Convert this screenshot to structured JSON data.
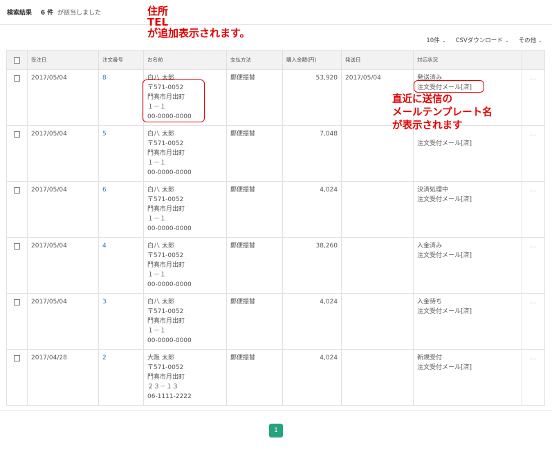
{
  "header": {
    "title": "検索結果",
    "count": "6 件",
    "message": "が該当しました"
  },
  "controls": {
    "page_size": "10件",
    "csv": "CSVダウンロード",
    "other": "その他"
  },
  "table": {
    "headers": [
      "受注日",
      "注文番号",
      "お名前",
      "支払方法",
      "購入金額(円)",
      "発送日",
      "対応状況"
    ],
    "rows": [
      {
        "date": "2017/05/04",
        "order": "8",
        "name": "白八 太郎",
        "zip": "〒571-0052",
        "addr1": "門真市月出町",
        "addr2": "１－１",
        "tel": "00-0000-0000",
        "pay": "郵便振替",
        "amount": "53,920",
        "ship": "2017/05/04",
        "status": "発送済み",
        "mail": "注文受付メール[済]"
      },
      {
        "date": "2017/05/04",
        "order": "5",
        "name": "白八 太郎",
        "zip": "〒571-0052",
        "addr1": "門真市月出町",
        "addr2": "１－１",
        "tel": "00-0000-0000",
        "pay": "郵便振替",
        "amount": "7,048",
        "ship": "",
        "status": "",
        "mail": "注文受付メール[済]"
      },
      {
        "date": "2017/05/04",
        "order": "6",
        "name": "白八 太郎",
        "zip": "〒571-0052",
        "addr1": "門真市月出町",
        "addr2": "１－１",
        "tel": "00-0000-0000",
        "pay": "郵便振替",
        "amount": "4,024",
        "ship": "",
        "status": "決済処理中",
        "mail": "注文受付メール[済]"
      },
      {
        "date": "2017/05/04",
        "order": "4",
        "name": "白八 太郎",
        "zip": "〒571-0052",
        "addr1": "門真市月出町",
        "addr2": "１－１",
        "tel": "00-0000-0000",
        "pay": "郵便振替",
        "amount": "38,260",
        "ship": "",
        "status": "入金済み",
        "mail": "注文受付メール[済]"
      },
      {
        "date": "2017/05/04",
        "order": "3",
        "name": "白八 太郎",
        "zip": "〒571-0052",
        "addr1": "門真市月出町",
        "addr2": "１－１",
        "tel": "00-0000-0000",
        "pay": "郵便振替",
        "amount": "4,024",
        "ship": "",
        "status": "入金待ち",
        "mail": "注文受付メール[済]"
      },
      {
        "date": "2017/04/28",
        "order": "2",
        "name": "大阪 太郎",
        "zip": "〒571-0052",
        "addr1": "門真市月出町",
        "addr2": "２３－１３",
        "tel": "06-1111-2222",
        "pay": "郵便振替",
        "amount": "4,024",
        "ship": "",
        "status": "新規受付",
        "mail": "注文受付メール[済]"
      }
    ],
    "more": "…"
  },
  "annotations": {
    "a1_line1": "住所",
    "a1_line2": "TEL",
    "a1_line3": "が追加表示されます。",
    "a2_line1": "直近に送信の",
    "a2_line2": "メールテンプレート名",
    "a2_line3": "が表示されます"
  },
  "pagination": {
    "current": "1"
  },
  "colors": {
    "accent": "#25a37f",
    "annotation": "#e30000",
    "link": "#2b7bb9"
  }
}
